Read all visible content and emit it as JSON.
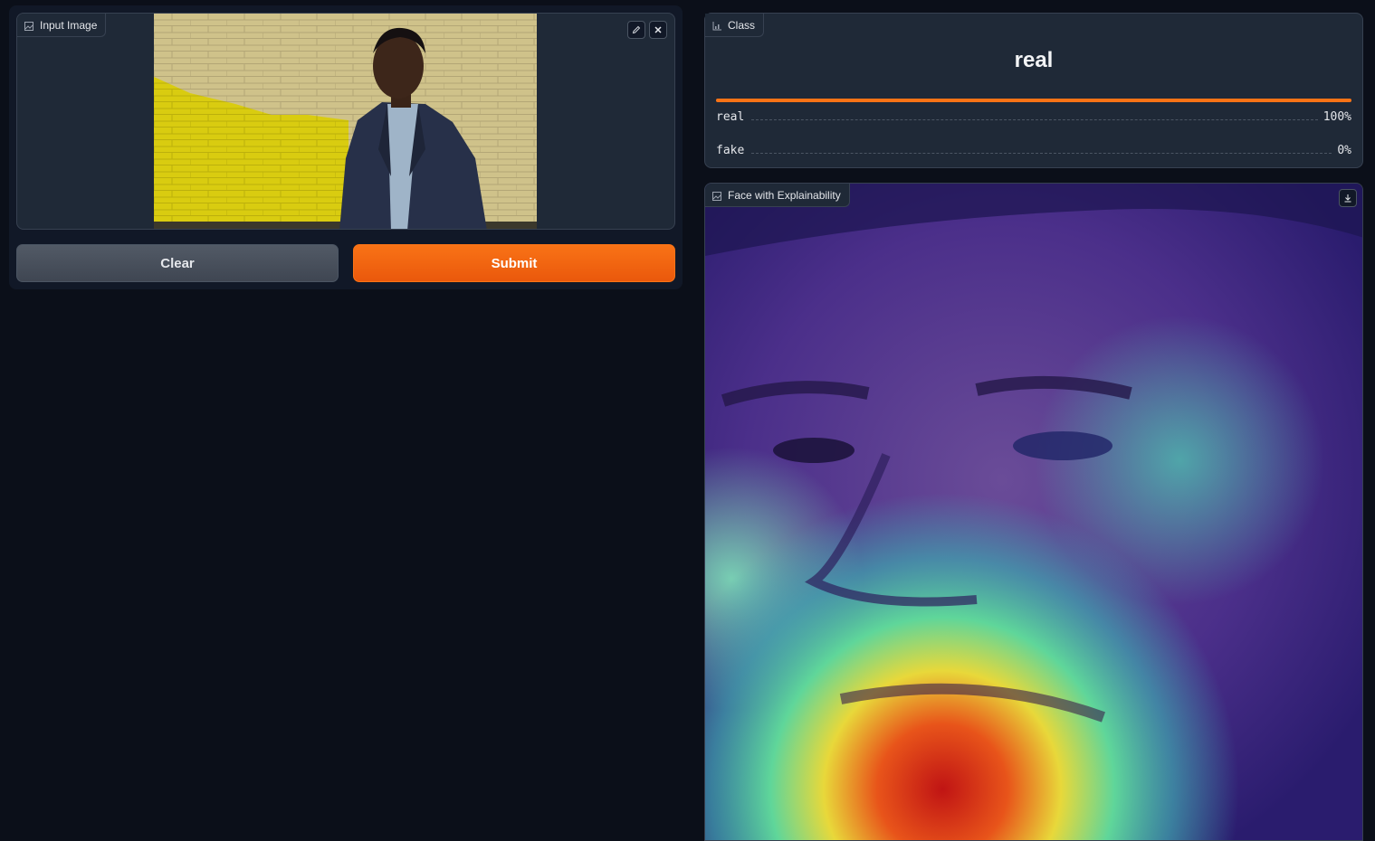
{
  "input_panel": {
    "label": "Input Image",
    "label_icon": "image-icon",
    "edit_icon": "pencil-icon",
    "close_icon": "close-icon"
  },
  "buttons": {
    "clear_label": "Clear",
    "submit_label": "Submit"
  },
  "class_panel": {
    "label": "Class",
    "label_icon": "bar-chart-icon",
    "predicted": "real",
    "confidences": [
      {
        "label": "real",
        "value": "100%",
        "fraction": 1.0
      },
      {
        "label": "fake",
        "value": "0%",
        "fraction": 0.0
      }
    ]
  },
  "face_panel": {
    "label": "Face with Explainability",
    "label_icon": "image-icon",
    "download_icon": "download-icon"
  },
  "colors": {
    "background": "#0b0f19",
    "panel": "#1f2937",
    "accent": "#f97316"
  }
}
